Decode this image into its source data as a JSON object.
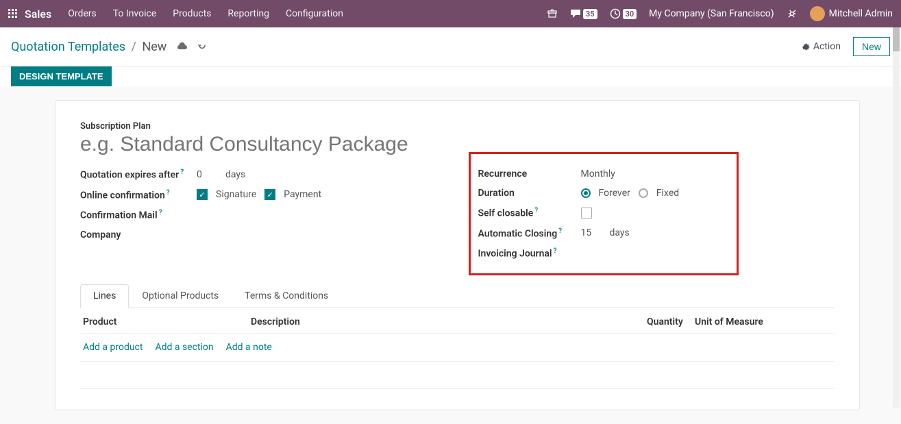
{
  "topbar": {
    "brand": "Sales",
    "menu": [
      "Orders",
      "To Invoice",
      "Products",
      "Reporting",
      "Configuration"
    ],
    "msg_count": "35",
    "clock_count": "30",
    "company": "My Company (San Francisco)",
    "user": "Mitchell Admin"
  },
  "breadcrumb": {
    "parent": "Quotation Templates",
    "current": "New"
  },
  "actions": {
    "action": "Action",
    "new": "New"
  },
  "ribbon": {
    "design": "DESIGN TEMPLATE"
  },
  "form": {
    "section_label": "Subscription Plan",
    "title_placeholder": "e.g. Standard Consultancy Package",
    "left": {
      "expires_label": "Quotation expires after",
      "expires_value": "0",
      "expires_unit": "days",
      "online_conf_label": "Online confirmation",
      "signature": "Signature",
      "payment": "Payment",
      "conf_mail_label": "Confirmation Mail",
      "company_label": "Company"
    },
    "right": {
      "recurrence_label": "Recurrence",
      "recurrence_value": "Monthly",
      "duration_label": "Duration",
      "duration_forever": "Forever",
      "duration_fixed": "Fixed",
      "self_closable_label": "Self closable",
      "auto_close_label": "Automatic Closing",
      "auto_close_value": "15",
      "auto_close_unit": "days",
      "invoicing_journal_label": "Invoicing Journal"
    }
  },
  "tabs": [
    "Lines",
    "Optional Products",
    "Terms & Conditions"
  ],
  "table": {
    "headers": {
      "product": "Product",
      "description": "Description",
      "quantity": "Quantity",
      "uom": "Unit of Measure"
    },
    "actions": {
      "add_product": "Add a product",
      "add_section": "Add a section",
      "add_note": "Add a note"
    }
  }
}
